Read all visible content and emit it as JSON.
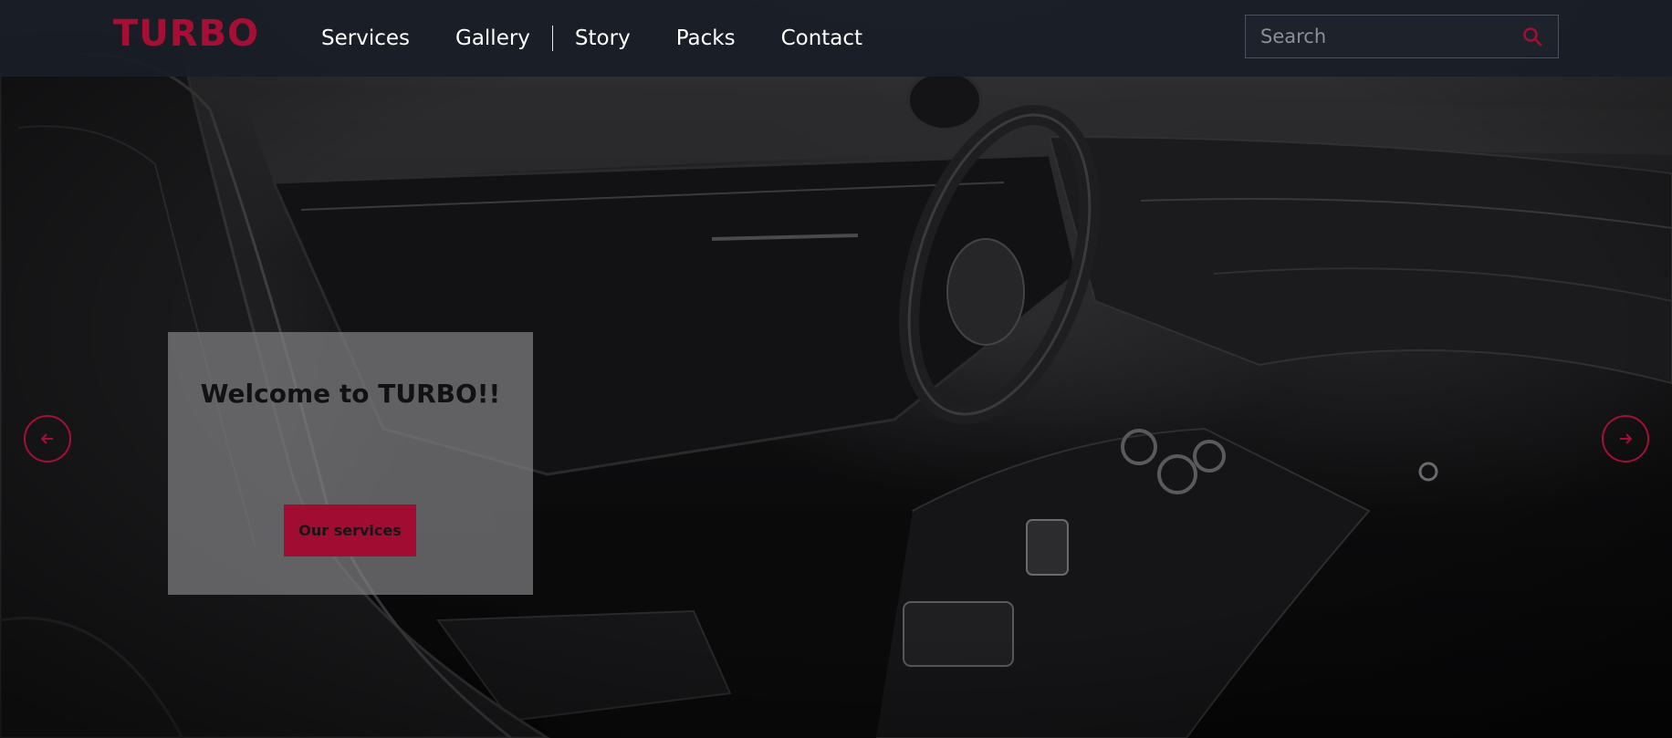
{
  "brand": {
    "logo_text": "TURBO",
    "accent_color": "#a50f35"
  },
  "nav": {
    "items": [
      {
        "label": "Services"
      },
      {
        "label": "Gallery"
      },
      {
        "label": "Story"
      },
      {
        "label": "Packs"
      },
      {
        "label": "Contact"
      }
    ]
  },
  "search": {
    "placeholder": "Search",
    "value": "",
    "icon": "search-icon"
  },
  "hero": {
    "welcome_title": "Welcome to TURBO!!",
    "cta_label": "Our services",
    "prev_icon": "arrow-left-icon",
    "next_icon": "arrow-right-icon"
  }
}
